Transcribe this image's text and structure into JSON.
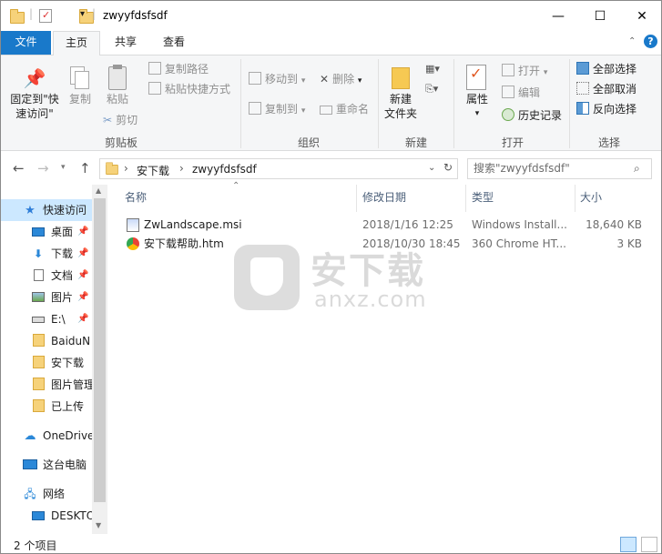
{
  "window": {
    "title": "zwyyfdsfsdf",
    "minimize_glyph": "—",
    "maximize_glyph": "☐",
    "close_glyph": "✕"
  },
  "tabs": [
    {
      "label": "文件"
    },
    {
      "label": "主页"
    },
    {
      "label": "共享"
    },
    {
      "label": "查看"
    }
  ],
  "ribbon": {
    "clipboard": {
      "pin_label_1": "固定到\"快",
      "pin_label_2": "速访问\"",
      "copy_label": "复制",
      "paste_label": "粘贴",
      "copy_path_label": "复制路径",
      "paste_shortcut_label": "粘贴快捷方式",
      "cut_label": "剪切",
      "group_label": "剪贴板"
    },
    "organize": {
      "move_to_label": "移动到",
      "copy_to_label": "复制到",
      "delete_label": "删除",
      "rename_label": "重命名",
      "group_label": "组织"
    },
    "new": {
      "new_folder_1": "新建",
      "new_folder_2": "文件夹",
      "group_label": "新建"
    },
    "open": {
      "properties_label": "属性",
      "open_label": "打开",
      "edit_label": "编辑",
      "history_label": "历史记录",
      "group_label": "打开"
    },
    "select": {
      "select_all_label": "全部选择",
      "select_none_label": "全部取消",
      "invert_label": "反向选择",
      "group_label": "选择"
    }
  },
  "address": {
    "crumbs": [
      "安下载",
      "zwyyfdsfsdf"
    ],
    "search_placeholder": "搜索\"zwyyfdsfsdf\""
  },
  "nav": [
    {
      "label": "快速访问",
      "icon": "star-icon"
    },
    {
      "label": "桌面",
      "icon": "desktop-icon"
    },
    {
      "label": "下载",
      "icon": "download-icon"
    },
    {
      "label": "文档",
      "icon": "document-icon"
    },
    {
      "label": "图片",
      "icon": "picture-icon"
    },
    {
      "label": "E:\\",
      "icon": "drive-icon"
    },
    {
      "label": "BaiduN",
      "icon": "folder-icon"
    },
    {
      "label": "安下载",
      "icon": "folder-icon"
    },
    {
      "label": "图片管理",
      "icon": "folder-icon"
    },
    {
      "label": "已上传",
      "icon": "folder-icon"
    },
    {
      "label": "OneDrive",
      "icon": "cloud-icon"
    },
    {
      "label": "这台电脑",
      "icon": "computer-icon"
    },
    {
      "label": "网络",
      "icon": "network-icon"
    },
    {
      "label": "DESKTO",
      "icon": "monitor-icon"
    }
  ],
  "columns": {
    "name": "名称",
    "date": "修改日期",
    "type": "类型",
    "size": "大小"
  },
  "files": [
    {
      "name": "ZwLandscape.msi",
      "date": "2018/1/16 12:25",
      "type": "Windows Install...",
      "size": "18,640 KB"
    },
    {
      "name": "安下载帮助.htm",
      "date": "2018/10/30 18:45",
      "type": "360 Chrome HT...",
      "size": "3 KB"
    }
  ],
  "status": {
    "count": "2 个项目"
  },
  "watermark": {
    "line1": "安下载",
    "line2": "anxz.com"
  },
  "colors": {
    "accent": "#1979ca",
    "folder": "#f6d27a",
    "selection": "#cce8ff"
  }
}
